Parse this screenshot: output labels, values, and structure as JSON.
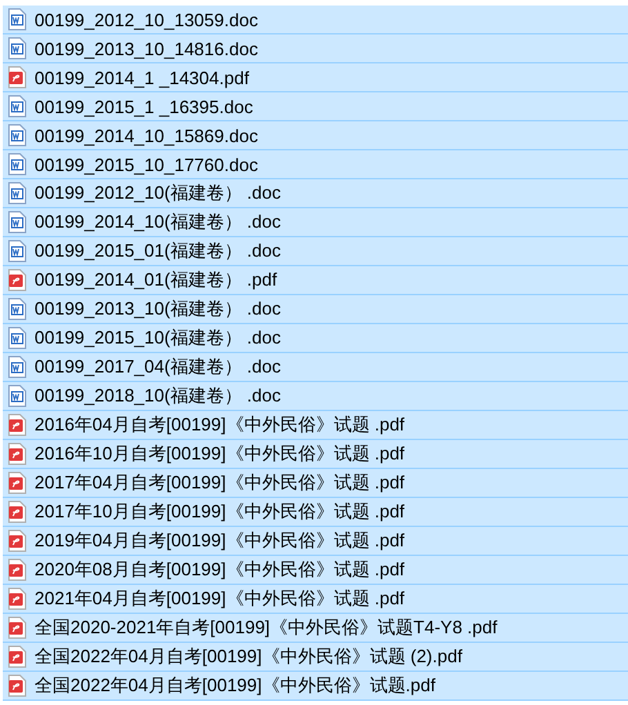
{
  "files": [
    {
      "name": "00199_2012_10_13059.doc",
      "kind": "doc",
      "selected": true
    },
    {
      "name": "00199_2013_10_14816.doc",
      "kind": "doc",
      "selected": true
    },
    {
      "name": "00199_2014_1 _14304.pdf",
      "kind": "pdf",
      "selected": true
    },
    {
      "name": "00199_2015_1 _16395.doc",
      "kind": "doc",
      "selected": true
    },
    {
      "name": "00199_2014_10_15869.doc",
      "kind": "doc",
      "selected": true
    },
    {
      "name": "00199_2015_10_17760.doc",
      "kind": "doc",
      "selected": true
    },
    {
      "name": "00199_2012_10(福建卷） .doc",
      "kind": "doc",
      "selected": true
    },
    {
      "name": "00199_2014_10(福建卷） .doc",
      "kind": "doc",
      "selected": true
    },
    {
      "name": "00199_2015_01(福建卷） .doc",
      "kind": "doc",
      "selected": true
    },
    {
      "name": "00199_2014_01(福建卷） .pdf",
      "kind": "pdf",
      "selected": true
    },
    {
      "name": "00199_2013_10(福建卷） .doc",
      "kind": "doc",
      "selected": true
    },
    {
      "name": "00199_2015_10(福建卷） .doc",
      "kind": "doc",
      "selected": true
    },
    {
      "name": "00199_2017_04(福建卷） .doc",
      "kind": "doc",
      "selected": true
    },
    {
      "name": "00199_2018_10(福建卷） .doc",
      "kind": "doc",
      "selected": true
    },
    {
      "name": "2016年04月自考[00199]《中外民俗》试题 .pdf",
      "kind": "pdf",
      "selected": true
    },
    {
      "name": "2016年10月自考[00199]《中外民俗》试题 .pdf",
      "kind": "pdf",
      "selected": true
    },
    {
      "name": "2017年04月自考[00199]《中外民俗》试题 .pdf",
      "kind": "pdf",
      "selected": true
    },
    {
      "name": "2017年10月自考[00199]《中外民俗》试题 .pdf",
      "kind": "pdf",
      "selected": true
    },
    {
      "name": "2019年04月自考[00199]《中外民俗》试题 .pdf",
      "kind": "pdf",
      "selected": true
    },
    {
      "name": "2020年08月自考[00199]《中外民俗》试题 .pdf",
      "kind": "pdf",
      "selected": true
    },
    {
      "name": "2021年04月自考[00199]《中外民俗》试题 .pdf",
      "kind": "pdf",
      "selected": true
    },
    {
      "name": "全国2020-2021年自考[00199]《中外民俗》试题T4-Y8 .pdf",
      "kind": "pdf",
      "selected": true
    },
    {
      "name": "全国2022年04月自考[00199]《中外民俗》试题 (2).pdf",
      "kind": "pdf",
      "selected": true
    },
    {
      "name": "全国2022年04月自考[00199]《中外民俗》试题.pdf",
      "kind": "pdf",
      "selected": true
    }
  ]
}
